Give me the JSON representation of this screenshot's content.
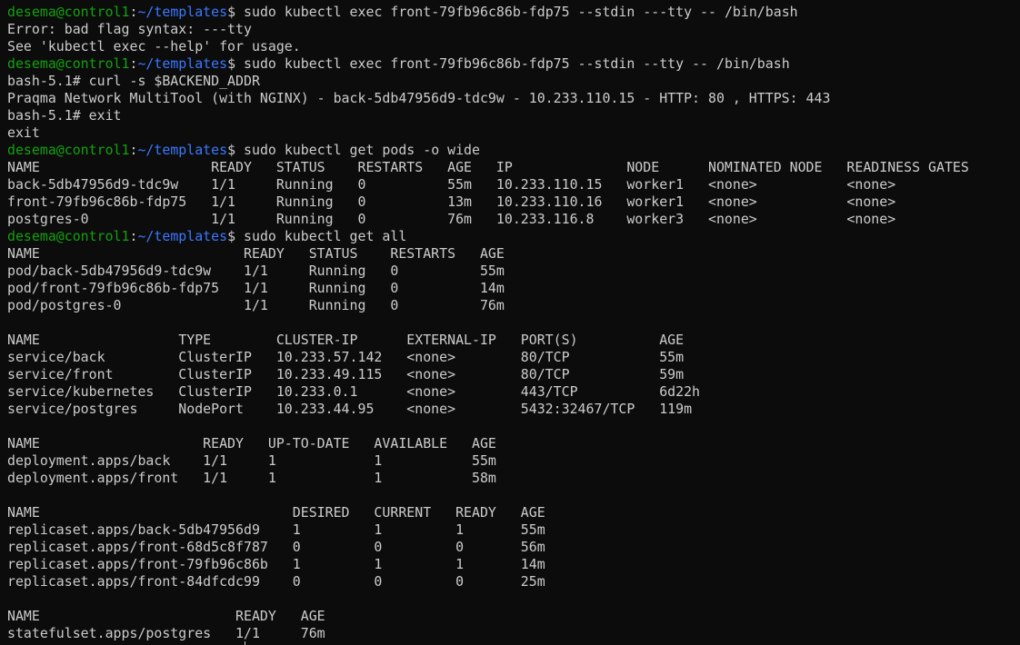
{
  "colors": {
    "background": "#0c0c0c",
    "text": "#cccccc",
    "prompt_user": "#13a10e",
    "prompt_path": "#3b78ff"
  },
  "lines": [
    {
      "type": "prompt",
      "user": "desema@control1",
      "sep": ":",
      "path": "~/templates",
      "cmd": "$ sudo kubectl exec front-79fb96c86b-fdp75 --stdin ---tty -- /bin/bash"
    },
    {
      "type": "output",
      "text": "Error: bad flag syntax: ---tty"
    },
    {
      "type": "output",
      "text": "See 'kubectl exec --help' for usage."
    },
    {
      "type": "prompt",
      "user": "desema@control1",
      "sep": ":",
      "path": "~/templates",
      "cmd": "$ sudo kubectl exec front-79fb96c86b-fdp75 --stdin --tty -- /bin/bash"
    },
    {
      "type": "output",
      "text": "bash-5.1# curl -s $BACKEND_ADDR"
    },
    {
      "type": "output",
      "text": "Praqma Network MultiTool (with NGINX) - back-5db47956d9-tdc9w - 10.233.110.15 - HTTP: 80 , HTTPS: 443"
    },
    {
      "type": "output",
      "text": "bash-5.1# exit"
    },
    {
      "type": "output",
      "text": "exit"
    },
    {
      "type": "prompt",
      "user": "desema@control1",
      "sep": ":",
      "path": "~/templates",
      "cmd": "$ sudo kubectl get pods -o wide"
    },
    {
      "type": "output",
      "text": "NAME                     READY   STATUS    RESTARTS   AGE   IP              NODE      NOMINATED NODE   READINESS GATES"
    },
    {
      "type": "output",
      "text": "back-5db47956d9-tdc9w    1/1     Running   0          55m   10.233.110.15   worker1   <none>           <none>"
    },
    {
      "type": "output",
      "text": "front-79fb96c86b-fdp75   1/1     Running   0          13m   10.233.110.16   worker1   <none>           <none>"
    },
    {
      "type": "output",
      "text": "postgres-0               1/1     Running   0          76m   10.233.116.8    worker3   <none>           <none>"
    },
    {
      "type": "prompt",
      "user": "desema@control1",
      "sep": ":",
      "path": "~/templates",
      "cmd": "$ sudo kubectl get all"
    },
    {
      "type": "output",
      "text": "NAME                         READY   STATUS    RESTARTS   AGE"
    },
    {
      "type": "output",
      "text": "pod/back-5db47956d9-tdc9w    1/1     Running   0          55m"
    },
    {
      "type": "output",
      "text": "pod/front-79fb96c86b-fdp75   1/1     Running   0          14m"
    },
    {
      "type": "output",
      "text": "pod/postgres-0               1/1     Running   0          76m"
    },
    {
      "type": "output",
      "text": ""
    },
    {
      "type": "output",
      "text": "NAME                 TYPE        CLUSTER-IP      EXTERNAL-IP   PORT(S)          AGE"
    },
    {
      "type": "output",
      "text": "service/back         ClusterIP   10.233.57.142   <none>        80/TCP           55m"
    },
    {
      "type": "output",
      "text": "service/front        ClusterIP   10.233.49.115   <none>        80/TCP           59m"
    },
    {
      "type": "output",
      "text": "service/kubernetes   ClusterIP   10.233.0.1      <none>        443/TCP          6d22h"
    },
    {
      "type": "output",
      "text": "service/postgres     NodePort    10.233.44.95    <none>        5432:32467/TCP   119m"
    },
    {
      "type": "output",
      "text": ""
    },
    {
      "type": "output",
      "text": "NAME                    READY   UP-TO-DATE   AVAILABLE   AGE"
    },
    {
      "type": "output",
      "text": "deployment.apps/back    1/1     1            1           55m"
    },
    {
      "type": "output",
      "text": "deployment.apps/front   1/1     1            1           58m"
    },
    {
      "type": "output",
      "text": ""
    },
    {
      "type": "output",
      "text": "NAME                               DESIRED   CURRENT   READY   AGE"
    },
    {
      "type": "output",
      "text": "replicaset.apps/back-5db47956d9    1         1         1       55m"
    },
    {
      "type": "output",
      "text": "replicaset.apps/front-68d5c8f787   0         0         0       56m"
    },
    {
      "type": "output",
      "text": "replicaset.apps/front-79fb96c86b   1         1         1       14m"
    },
    {
      "type": "output",
      "text": "replicaset.apps/front-84dfcdc99    0         0         0       25m"
    },
    {
      "type": "output",
      "text": ""
    },
    {
      "type": "output",
      "text": "NAME                        READY   AGE"
    },
    {
      "type": "output",
      "text": "statefulset.apps/postgres   1/1     76m"
    }
  ]
}
